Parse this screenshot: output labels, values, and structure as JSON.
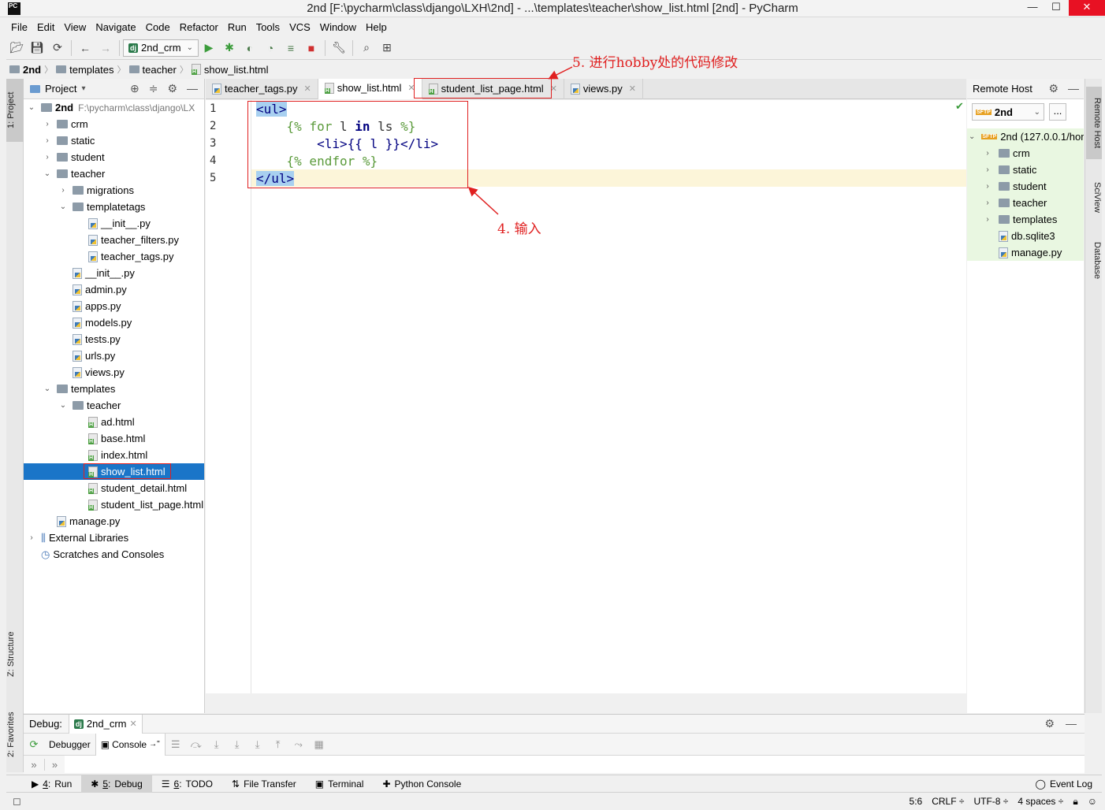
{
  "window": {
    "title": "2nd [F:\\pycharm\\class\\django\\LXH\\2nd] - ...\\templates\\teacher\\show_list.html [2nd] - PyCharm",
    "app_icon_text": "PC",
    "controls": {
      "minimize": "—",
      "maximize": "☐",
      "close": "✕"
    }
  },
  "menu": [
    "File",
    "Edit",
    "View",
    "Navigate",
    "Code",
    "Refactor",
    "Run",
    "Tools",
    "VCS",
    "Window",
    "Help"
  ],
  "toolbar": {
    "run_config": "2nd_crm",
    "run_config_badge": "dj"
  },
  "breadcrumb": [
    "2nd",
    "templates",
    "teacher",
    "show_list.html"
  ],
  "left_strip": {
    "project": "1: Project",
    "structure": "Z: Structure",
    "favorites": "2: Favorites"
  },
  "project": {
    "header": "Project",
    "tree": [
      {
        "label": "2nd",
        "path": "F:\\pycharm\\class\\django\\LX",
        "type": "folder",
        "depth": 0,
        "arrow": "⌄",
        "bold": true
      },
      {
        "label": "crm",
        "type": "folder",
        "depth": 1,
        "arrow": "›"
      },
      {
        "label": "static",
        "type": "folder",
        "depth": 1,
        "arrow": "›"
      },
      {
        "label": "student",
        "type": "folder",
        "depth": 1,
        "arrow": "›"
      },
      {
        "label": "teacher",
        "type": "folder",
        "depth": 1,
        "arrow": "⌄"
      },
      {
        "label": "migrations",
        "type": "folder",
        "depth": 2,
        "arrow": "›"
      },
      {
        "label": "templatetags",
        "type": "folder",
        "depth": 2,
        "arrow": "⌄"
      },
      {
        "label": "__init__.py",
        "type": "py",
        "depth": 3,
        "arrow": ""
      },
      {
        "label": "teacher_filters.py",
        "type": "py",
        "depth": 3,
        "arrow": ""
      },
      {
        "label": "teacher_tags.py",
        "type": "py",
        "depth": 3,
        "arrow": ""
      },
      {
        "label": "__init__.py",
        "type": "py",
        "depth": 2,
        "arrow": ""
      },
      {
        "label": "admin.py",
        "type": "py",
        "depth": 2,
        "arrow": ""
      },
      {
        "label": "apps.py",
        "type": "py",
        "depth": 2,
        "arrow": ""
      },
      {
        "label": "models.py",
        "type": "py",
        "depth": 2,
        "arrow": ""
      },
      {
        "label": "tests.py",
        "type": "py",
        "depth": 2,
        "arrow": ""
      },
      {
        "label": "urls.py",
        "type": "py",
        "depth": 2,
        "arrow": ""
      },
      {
        "label": "views.py",
        "type": "py",
        "depth": 2,
        "arrow": ""
      },
      {
        "label": "templates",
        "type": "folder",
        "depth": 1,
        "arrow": "⌄"
      },
      {
        "label": "teacher",
        "type": "folder",
        "depth": 2,
        "arrow": "⌄"
      },
      {
        "label": "ad.html",
        "type": "html",
        "depth": 3,
        "arrow": ""
      },
      {
        "label": "base.html",
        "type": "html",
        "depth": 3,
        "arrow": ""
      },
      {
        "label": "index.html",
        "type": "html",
        "depth": 3,
        "arrow": ""
      },
      {
        "label": "show_list.html",
        "type": "html",
        "depth": 3,
        "arrow": "",
        "selected": true
      },
      {
        "label": "student_detail.html",
        "type": "html",
        "depth": 3,
        "arrow": ""
      },
      {
        "label": "student_list_page.html",
        "type": "html",
        "depth": 3,
        "arrow": ""
      },
      {
        "label": "manage.py",
        "type": "py",
        "depth": 1,
        "arrow": ""
      },
      {
        "label": "External Libraries",
        "type": "lib",
        "depth": 0,
        "arrow": "›"
      },
      {
        "label": "Scratches and Consoles",
        "type": "scratch",
        "depth": 0,
        "arrow": ""
      }
    ]
  },
  "editor_tabs": [
    {
      "label": "teacher_tags.py",
      "type": "py",
      "active": false
    },
    {
      "label": "show_list.html",
      "type": "html",
      "active": true
    },
    {
      "label": "student_list_page.html",
      "type": "html",
      "active": false
    },
    {
      "label": "views.py",
      "type": "py",
      "active": false
    }
  ],
  "editor": {
    "line_numbers": [
      "1",
      "2",
      "3",
      "4",
      "5"
    ],
    "code": {
      "l1": "<ul>",
      "l2_open": "{%",
      "l2_for": "for",
      "l2_l": "l",
      "l2_in": "in",
      "l2_ls": "ls",
      "l2_close": "%}",
      "l3": "<li>{{ l }}</li>",
      "l4": "{% endfor %}",
      "l5": "</ul>"
    }
  },
  "annotations": {
    "step4": "4. 输入",
    "step5": "5. 进行hobby处的代码修改"
  },
  "remote_host": {
    "header": "Remote Host",
    "server": "2nd",
    "server_badge": "SFTP",
    "more_button": "...",
    "root": "2nd (127.0.0.1/hom",
    "items": [
      {
        "label": "crm",
        "type": "folder",
        "arrow": "›"
      },
      {
        "label": "static",
        "type": "folder",
        "arrow": "›"
      },
      {
        "label": "student",
        "type": "folder",
        "arrow": "›"
      },
      {
        "label": "teacher",
        "type": "folder",
        "arrow": "›"
      },
      {
        "label": "templates",
        "type": "folder",
        "arrow": "›"
      },
      {
        "label": "db.sqlite3",
        "type": "file",
        "arrow": ""
      },
      {
        "label": "manage.py",
        "type": "py",
        "arrow": ""
      }
    ]
  },
  "right_strip": {
    "remote_host": "Remote Host",
    "sciview": "SciView",
    "database": "Database"
  },
  "debug": {
    "label": "Debug:",
    "session": "2nd_crm",
    "tabs": {
      "debugger": "Debugger",
      "console": "Console"
    },
    "prompt": "»"
  },
  "tool_windows": [
    {
      "num": "4",
      "label": "Run",
      "icon": "▶"
    },
    {
      "num": "5",
      "label": "Debug",
      "icon": "✱",
      "active": true
    },
    {
      "num": "6",
      "label": "TODO",
      "icon": "☰"
    },
    {
      "num": "",
      "label": "File Transfer",
      "icon": "⇅"
    },
    {
      "num": "",
      "label": "Terminal",
      "icon": "▣"
    },
    {
      "num": "",
      "label": "Python Console",
      "icon": "✚"
    }
  ],
  "event_log": "Event Log",
  "status": {
    "position": "5:6",
    "line_sep": "CRLF ÷",
    "encoding": "UTF-8 ÷",
    "indent": "4 spaces ÷"
  }
}
